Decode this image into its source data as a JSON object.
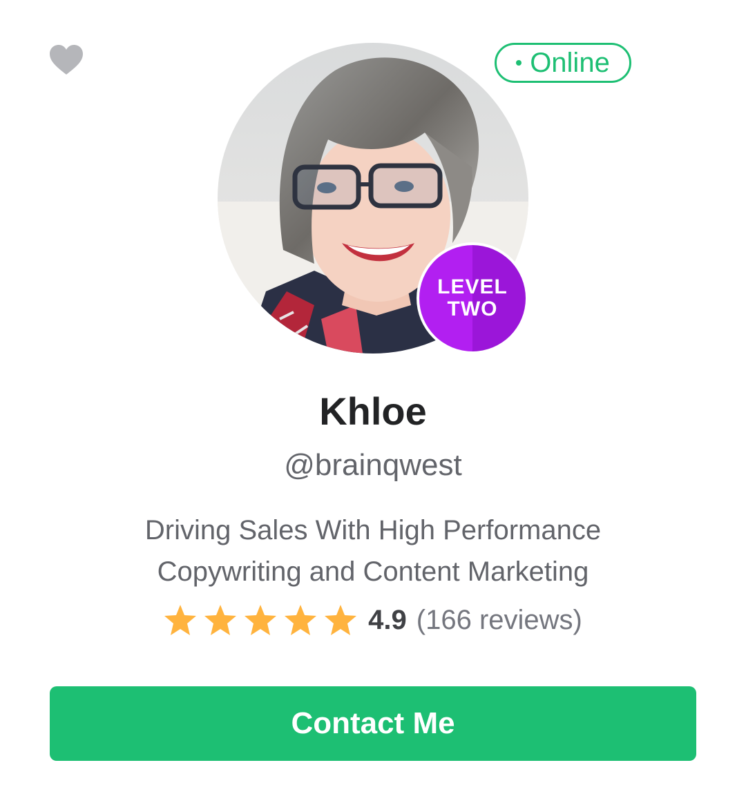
{
  "header": {
    "favorite_icon": "heart-icon",
    "status_label": "Online",
    "status_color": "#1dbf73"
  },
  "profile": {
    "level_line1": "LEVEL",
    "level_line2": "TWO",
    "level_color": "#b21ff1",
    "name": "Khloe",
    "username": "@brainqwest",
    "tagline": "Driving Sales With High Performance Copywriting and Content Marketing"
  },
  "rating": {
    "stars": 5,
    "star_icon": "star-icon",
    "star_color": "#ffb33e",
    "score": "4.9",
    "reviews": "(166 reviews)"
  },
  "actions": {
    "contact_label": "Contact Me",
    "accent": "#1dbf73"
  }
}
